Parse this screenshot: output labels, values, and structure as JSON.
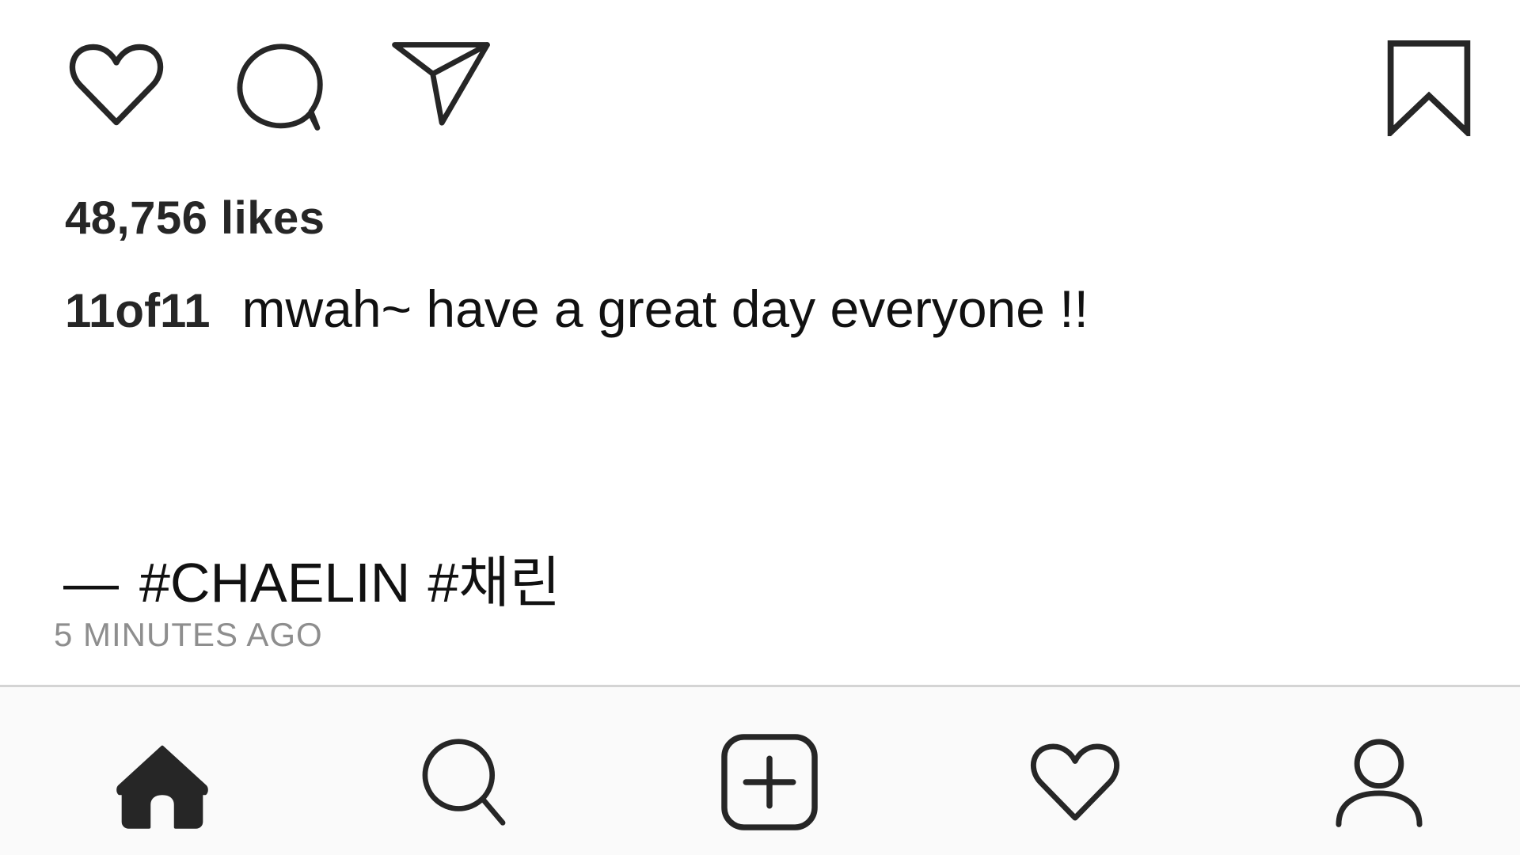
{
  "post": {
    "actions": {
      "like_icon": "heart-outline",
      "comment_icon": "speech-bubble",
      "share_icon": "paper-plane",
      "save_icon": "bookmark-outline"
    },
    "likes": "48,756 likes",
    "username": "11of11",
    "caption": "mwah~ have a great day everyone !!",
    "dash": "—",
    "hashtags": [
      "#CHAELIN",
      "#채린"
    ],
    "timestamp": "5 MINUTES AGO"
  },
  "tab_bar": {
    "items": [
      {
        "name": "home",
        "icon": "home-filled",
        "active": true
      },
      {
        "name": "search",
        "icon": "magnifier",
        "active": false
      },
      {
        "name": "new-post",
        "icon": "plus-square",
        "active": false
      },
      {
        "name": "activity",
        "icon": "heart-outline",
        "active": false
      },
      {
        "name": "profile",
        "icon": "person-outline",
        "active": false
      }
    ]
  },
  "colors": {
    "text": "#111111",
    "secondary_text": "#8e8e8e",
    "tab_bar_bg": "#fafafa",
    "divider": "#d4d4d4"
  }
}
